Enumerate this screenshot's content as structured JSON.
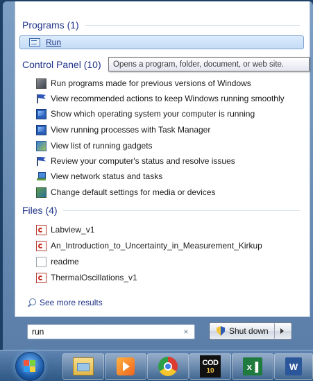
{
  "programs": {
    "header": "Programs (1)",
    "items": [
      {
        "label": "Run",
        "icon": "run-icon"
      }
    ]
  },
  "tooltip": "Opens a program, folder, document, or web site.",
  "control_panel": {
    "header": "Control Panel (10)",
    "items": [
      {
        "label": "Run programs made for previous versions of Windows",
        "icon": "program-compatibility-icon"
      },
      {
        "label": "View recommended actions to keep Windows running smoothly",
        "icon": "action-center-flag-icon"
      },
      {
        "label": "Show which operating system your computer is running",
        "icon": "system-monitor-icon"
      },
      {
        "label": "View running processes with Task Manager",
        "icon": "task-manager-icon"
      },
      {
        "label": "View list of running gadgets",
        "icon": "gadgets-icon"
      },
      {
        "label": "Review your computer's status and resolve issues",
        "icon": "action-center-flag-icon"
      },
      {
        "label": "View network status and tasks",
        "icon": "network-icon"
      },
      {
        "label": "Change default settings for media or devices",
        "icon": "autoplay-icon"
      }
    ]
  },
  "files": {
    "header": "Files (4)",
    "items": [
      {
        "label": "Labview_v1",
        "icon": "pdf-icon"
      },
      {
        "label": "An_Introduction_to_Uncertainty_in_Measurement_Kirkup",
        "icon": "pdf-icon"
      },
      {
        "label": "readme",
        "icon": "text-document-icon"
      },
      {
        "label": "ThermalOscillations_v1",
        "icon": "pdf-icon"
      }
    ]
  },
  "see_more": "See more results",
  "search": {
    "value": "run",
    "clear": "×"
  },
  "shutdown": {
    "label": "Shut down"
  },
  "taskbar": {
    "cod_line1": "COD",
    "cod_line2": "10",
    "excel_label": "x▐",
    "word_label": "W"
  }
}
